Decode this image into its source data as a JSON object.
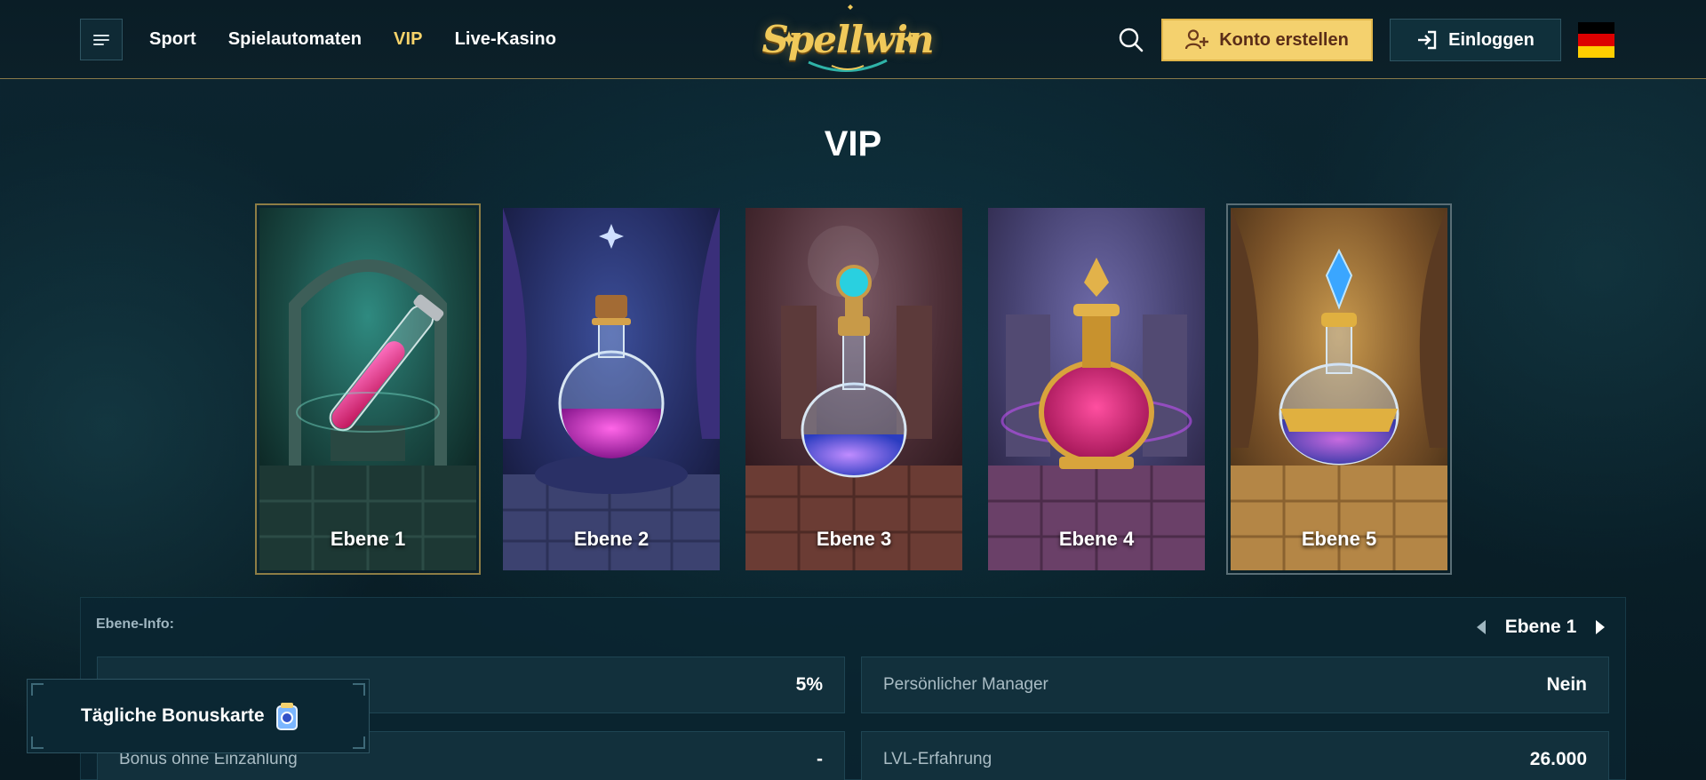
{
  "header": {
    "menu_icon": "hamburger-menu-icon",
    "nav": [
      {
        "label": "Sport",
        "active": false
      },
      {
        "label": "Spielautomaten",
        "active": false
      },
      {
        "label": "VIP",
        "active": true
      },
      {
        "label": "Live-Kasino",
        "active": false
      }
    ],
    "logo_text": "Spellwin",
    "search_icon": "search-icon",
    "register_label": "Konto erstellen",
    "login_label": "Einloggen",
    "flag": "germany-flag-icon"
  },
  "page": {
    "title": "VIP"
  },
  "levels": [
    {
      "label": "Ebene 1"
    },
    {
      "label": "Ebene 2"
    },
    {
      "label": "Ebene 3"
    },
    {
      "label": "Ebene 4"
    },
    {
      "label": "Ebene 5"
    }
  ],
  "info": {
    "section_label": "Ebene-Info:",
    "current_level": "Ebene 1",
    "rows": [
      {
        "key": "",
        "value": "5%"
      },
      {
        "key": "Persönlicher Manager",
        "value": "Nein"
      },
      {
        "key": "Bonus ohne Einzahlung",
        "value": "-"
      },
      {
        "key": "LVL-Erfahrung",
        "value": "26.000"
      }
    ]
  },
  "daily_bonus": {
    "label": "Tägliche Bonuskarte",
    "icon": "bonus-card-icon"
  },
  "colors": {
    "accent_gold": "#f4d16e",
    "nav_active": "#f6d36a",
    "background": "#0a222c"
  }
}
